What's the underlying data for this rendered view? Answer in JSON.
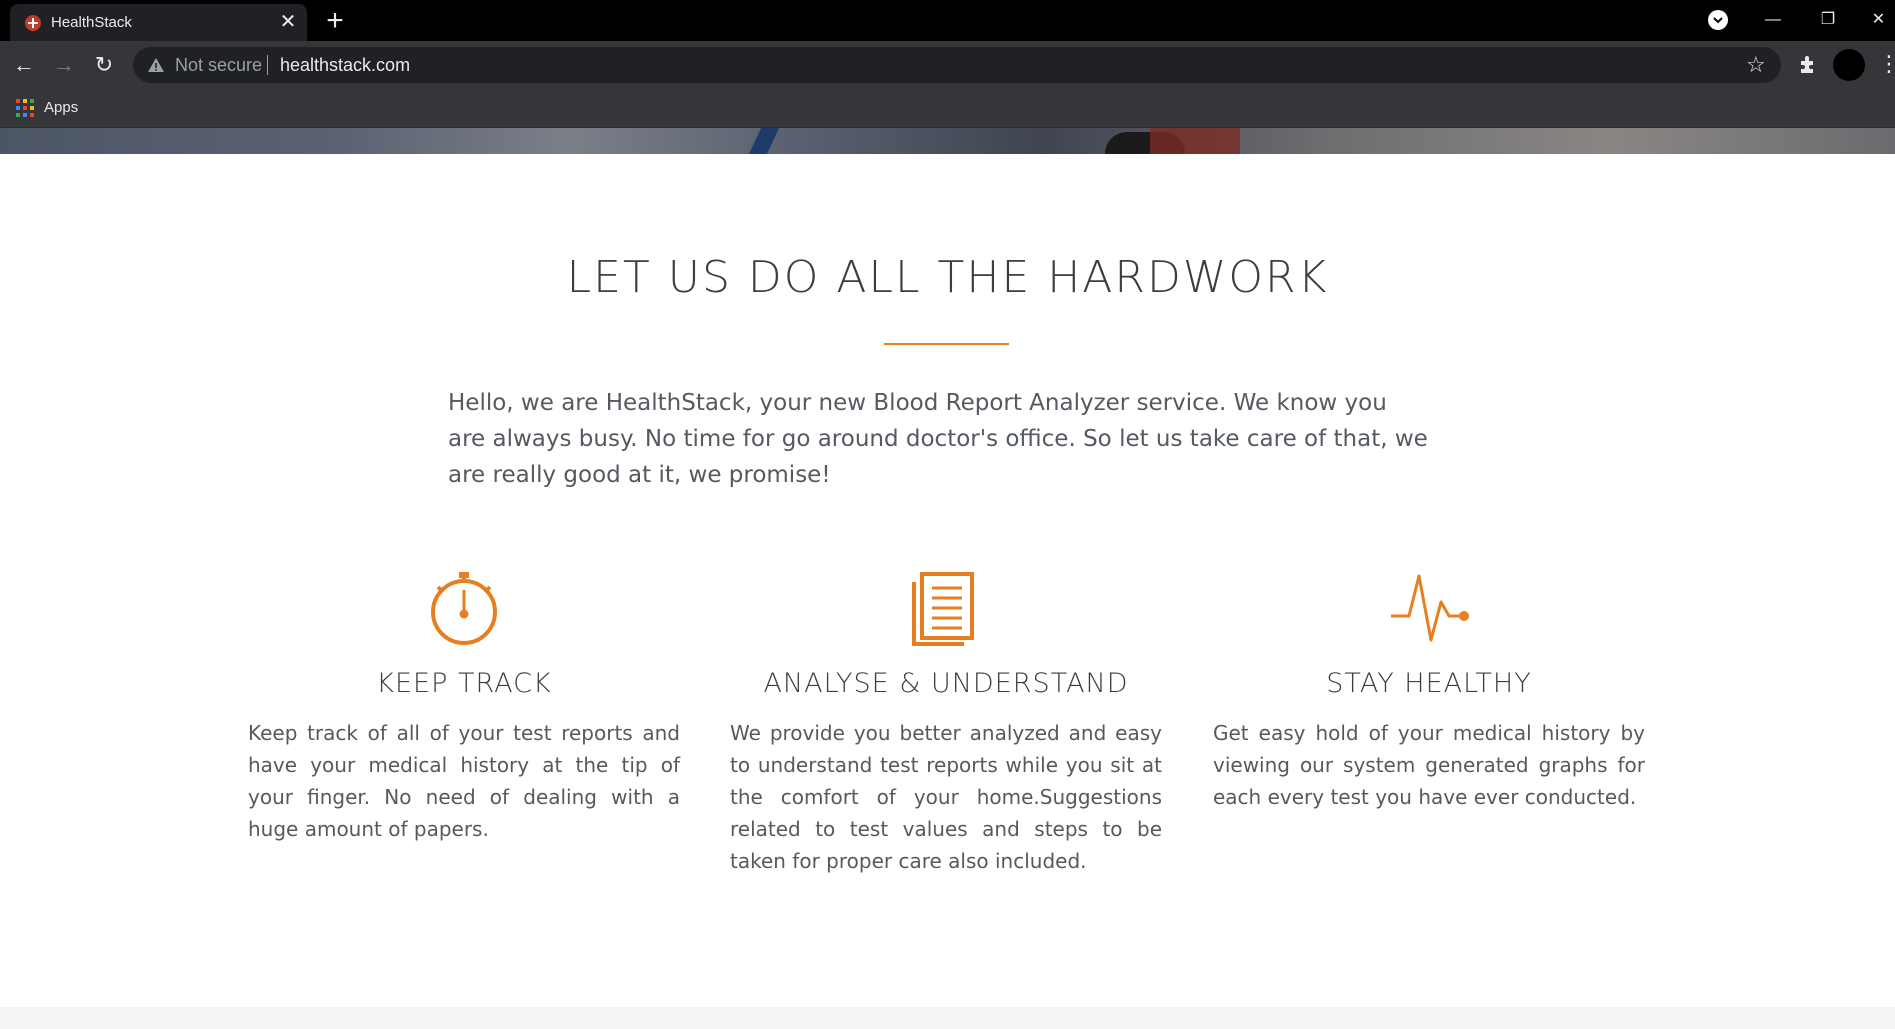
{
  "browser": {
    "tab_title": "HealthStack",
    "security_label": "Not secure",
    "url": "healthstack.com",
    "bookmarks_apps_label": "Apps"
  },
  "page": {
    "headline": "LET US DO ALL THE HARDWORK",
    "intro": "Hello, we are HealthStack, your new Blood Report Analyzer service. We know you are always busy. No time for go around doctor's office. So let us take care of that, we are really good at it, we promise!",
    "accent_color": "#e67e22",
    "features": [
      {
        "icon": "stopwatch-icon",
        "title": "KEEP TRACK",
        "text": "Keep track of all of your test reports and have your medical history at the tip of your finger. No need of dealing with a huge amount of papers."
      },
      {
        "icon": "document-list-icon",
        "title": "ANALYSE & UNDERSTAND",
        "text": "We provide you better analyzed and easy to understand test reports while you sit at the comfort of your home.Suggestions related to test values and steps to be taken for proper care also included."
      },
      {
        "icon": "heartbeat-icon",
        "title": "STAY HEALTHY",
        "text": "Get easy hold of your medical history by viewing our system generated graphs for each every test you have ever conducted."
      }
    ]
  }
}
